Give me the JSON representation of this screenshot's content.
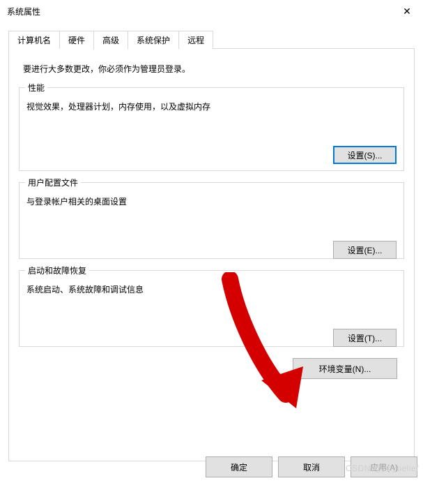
{
  "window": {
    "title": "系统属性",
    "close_glyph": "✕"
  },
  "tabs": [
    {
      "label": "计算机名"
    },
    {
      "label": "硬件"
    },
    {
      "label": "高级",
      "active": true
    },
    {
      "label": "系统保护"
    },
    {
      "label": "远程"
    }
  ],
  "intro": "要进行大多数更改，你必须作为管理员登录。",
  "groups": {
    "performance": {
      "title": "性能",
      "desc": "视觉效果，处理器计划，内存使用，以及虚拟内存",
      "button": "设置(S)..."
    },
    "user_profiles": {
      "title": "用户配置文件",
      "desc": "与登录帐户相关的桌面设置",
      "button": "设置(E)..."
    },
    "startup": {
      "title": "启动和故障恢复",
      "desc": "系统启动、系统故障和调试信息",
      "button": "设置(T)..."
    }
  },
  "env_button": "环境变量(N)...",
  "dialog": {
    "ok": "确定",
    "cancel": "取消",
    "apply": "应用(A)"
  },
  "watermark": "CSDN @phybelief",
  "annotation": {
    "arrow_color": "#d40000"
  }
}
